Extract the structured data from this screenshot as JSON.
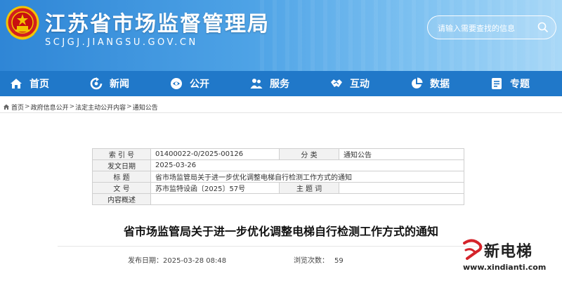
{
  "header": {
    "site_title": "江苏省市场监督管理局",
    "site_domain": "SCJGJ.JIANGSU.GOV.CN",
    "search_placeholder": "请输入需要查找的信息",
    "search_icon": "search-icon"
  },
  "nav": {
    "items": [
      {
        "label": "首页",
        "icon": "home-icon"
      },
      {
        "label": "新闻",
        "icon": "refresh-icon"
      },
      {
        "label": "公开",
        "icon": "open-icon"
      },
      {
        "label": "服务",
        "icon": "user-group-icon"
      },
      {
        "label": "互动",
        "icon": "handshake-icon"
      },
      {
        "label": "数据",
        "icon": "pie-chart-icon"
      },
      {
        "label": "专题",
        "icon": "topic-icon"
      }
    ]
  },
  "breadcrumb": {
    "items": [
      "首页",
      "政府信息公开",
      "法定主动公开内容",
      "通知公告"
    ],
    "separator": ">"
  },
  "info": {
    "index_label": "索 引 号",
    "index_value": "01400022-0/2025-00126",
    "category_label": "分 类",
    "category_value": "通知公告",
    "date_label": "发文日期",
    "date_value": "2025-03-26",
    "title_label": "标 题",
    "title_value": "省市场监管局关于进一步优化调整电梯自行检测工作方式的通知",
    "docno_label": "文 号",
    "docno_value": "苏市监特设函〔2025〕57号",
    "subject_label": "主 题 词",
    "subject_value": "",
    "summary_label": "内容概述",
    "summary_value": ""
  },
  "article": {
    "title": "省市场监管局关于进一步优化调整电梯自行检测工作方式的通知",
    "publish_label": "发布日期：",
    "publish_time": "2025-03-28 08:48",
    "views_label": "浏览次数：",
    "views": "59"
  },
  "watermark": {
    "name": "新电梯",
    "url": "www.xindianti.com"
  },
  "colors": {
    "nav_bg": "#2078c9",
    "header_bg_start": "#2f86d6",
    "header_bg_end": "#a9d8f7",
    "table_label_bg": "#f2f2f2",
    "watermark_red": "#d4232a"
  }
}
